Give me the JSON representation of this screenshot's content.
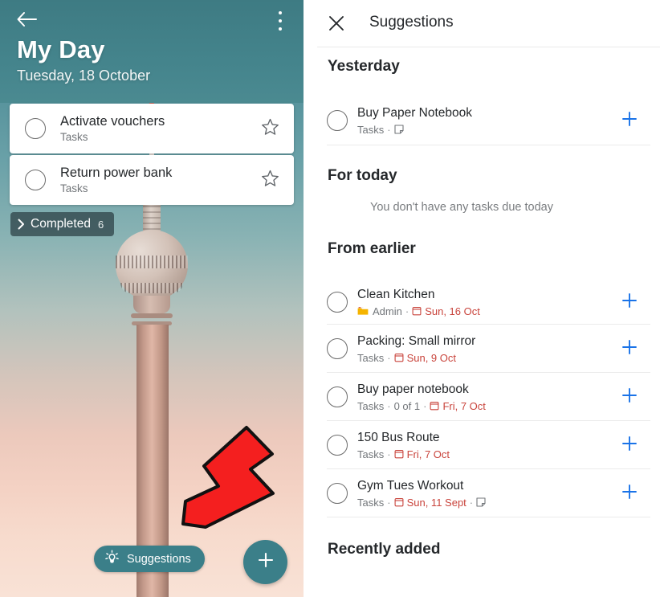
{
  "colors": {
    "teal": "#3b7f89",
    "header_teal": "#44848c",
    "accent_blue": "#1a73e8",
    "date_red": "#c9443c",
    "folder_amber": "#f5b400",
    "arrow_red": "#f41f1f",
    "text_primary": "#25282b",
    "text_secondary": "#72767a"
  },
  "left_panel": {
    "back_icon": "back-arrow-icon",
    "overflow_icon": "more-vert-icon",
    "title": "My Day",
    "subtitle": "Tuesday, 18 October",
    "tasks": [
      {
        "checkbox": "unchecked-circle",
        "title": "Activate vouchers",
        "list": "Tasks",
        "star": "star-outline-icon"
      },
      {
        "checkbox": "unchecked-circle",
        "title": "Return power bank",
        "list": "Tasks",
        "star": "star-outline-icon"
      }
    ],
    "completed_chip": {
      "chevron_icon": "chevron-right-icon",
      "label": "Completed",
      "count": "6"
    },
    "suggestions_button": {
      "icon": "lightbulb-icon",
      "label": "Suggestions"
    },
    "fab": {
      "icon": "plus-icon"
    },
    "annotation": {
      "icon": "red-arrow-pointing-down-left"
    }
  },
  "right_panel": {
    "close_icon": "close-icon",
    "title": "Suggestions",
    "sections": [
      {
        "heading": "Yesterday",
        "empty_text": "",
        "items": [
          {
            "title": "Buy Paper Notebook",
            "list": "Tasks",
            "progress": "",
            "date": "",
            "has_folder": false,
            "has_note": true,
            "add_icon": "plus-icon"
          }
        ]
      },
      {
        "heading": "For today",
        "empty_text": "You don't have any tasks due today",
        "items": []
      },
      {
        "heading": "From earlier",
        "empty_text": "",
        "items": [
          {
            "title": "Clean Kitchen",
            "list": "Admin",
            "progress": "",
            "date": "Sun, 16 Oct",
            "has_folder": true,
            "has_note": false,
            "add_icon": "plus-icon"
          },
          {
            "title": "Packing: Small mirror",
            "list": "Tasks",
            "progress": "",
            "date": "Sun, 9 Oct",
            "has_folder": false,
            "has_note": false,
            "add_icon": "plus-icon"
          },
          {
            "title": "Buy paper notebook",
            "list": "Tasks",
            "progress": "0 of 1",
            "date": "Fri, 7 Oct",
            "has_folder": false,
            "has_note": false,
            "add_icon": "plus-icon"
          },
          {
            "title": "150 Bus Route",
            "list": "Tasks",
            "progress": "",
            "date": "Fri, 7 Oct",
            "has_folder": false,
            "has_note": false,
            "add_icon": "plus-icon"
          },
          {
            "title": "Gym Tues Workout",
            "list": "Tasks",
            "progress": "",
            "date": "Sun, 11 Sept",
            "has_folder": false,
            "has_note": true,
            "add_icon": "plus-icon"
          }
        ]
      },
      {
        "heading": "Recently added",
        "empty_text": "",
        "items": []
      }
    ]
  }
}
